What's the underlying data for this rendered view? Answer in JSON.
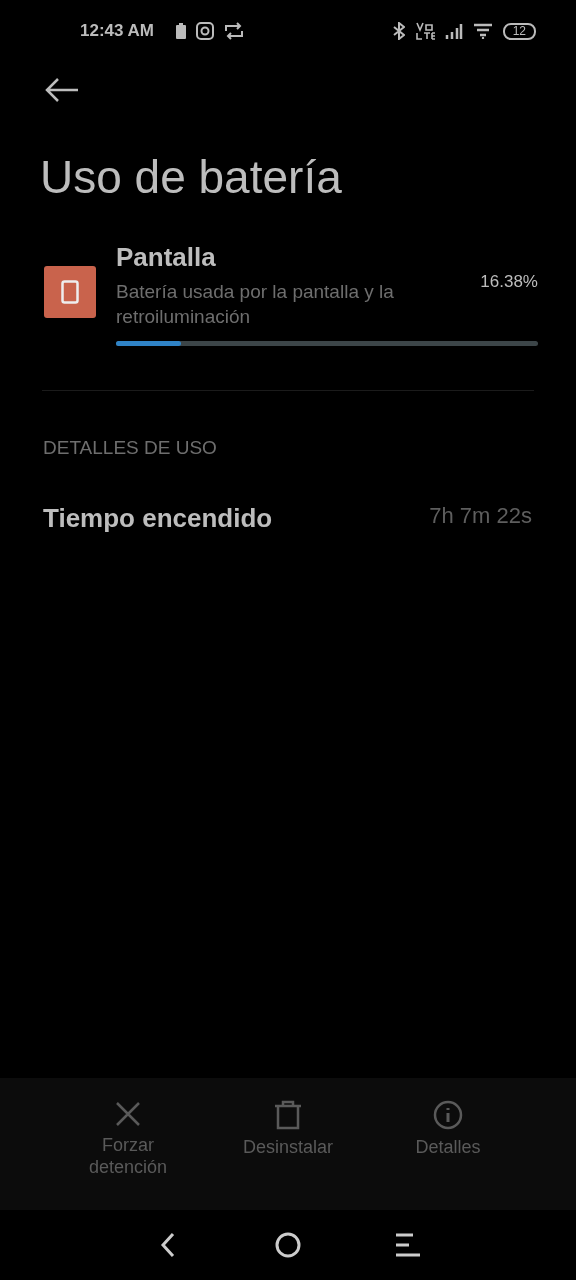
{
  "status_bar": {
    "time": "12:43 AM",
    "battery": "12"
  },
  "title": "Uso de batería",
  "app": {
    "name": "Pantalla",
    "description": "Batería usada por la pantalla y la retroiluminación",
    "percent": "16.38%",
    "level": 0.155
  },
  "section": "DETALLES DE USO",
  "details": [
    {
      "label": "Tiempo encendido",
      "value": "7h 7m 22s"
    }
  ],
  "actions": [
    {
      "kind": "stop",
      "label": "Forzar\ndetención"
    },
    {
      "kind": "uninstall",
      "label": "Desinstalar"
    },
    {
      "kind": "info",
      "label": "Detalles"
    }
  ]
}
